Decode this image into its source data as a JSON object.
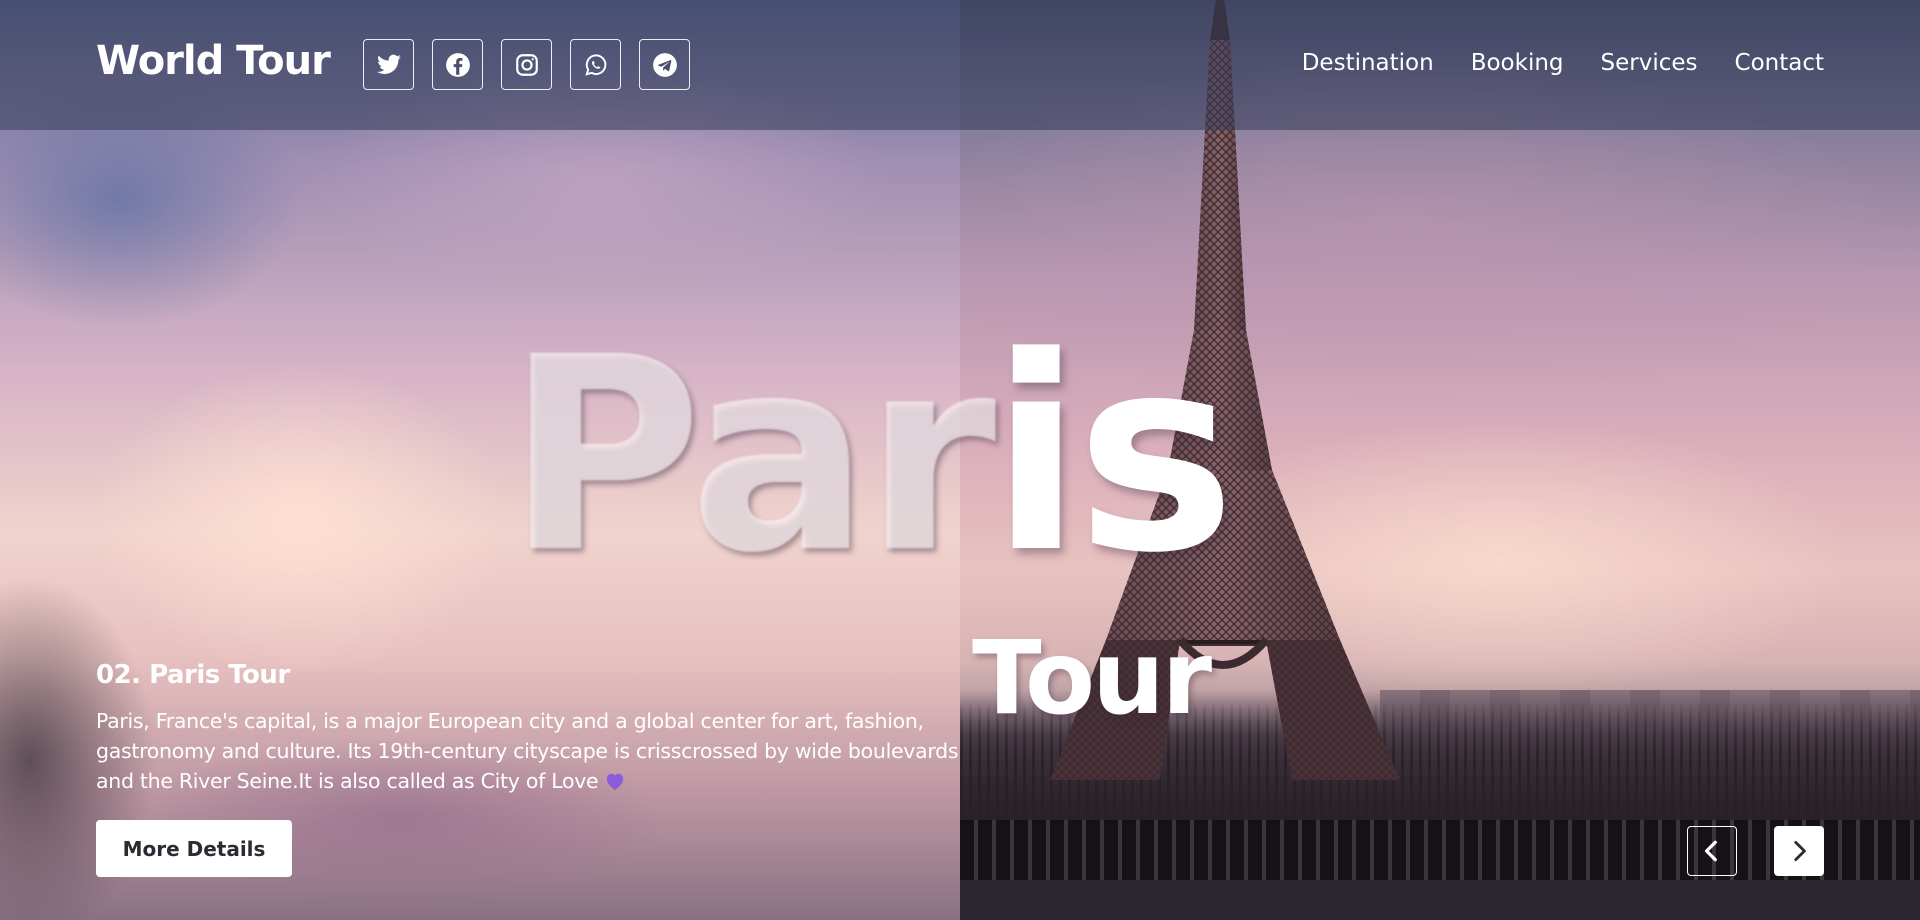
{
  "header": {
    "brand": "World Tour",
    "socials": [
      {
        "icon": "twitter-icon"
      },
      {
        "icon": "facebook-icon"
      },
      {
        "icon": "instagram-icon"
      },
      {
        "icon": "whatsapp-icon"
      },
      {
        "icon": "telegram-icon"
      }
    ],
    "nav": [
      "Destination",
      "Booking",
      "Services",
      "Contact"
    ]
  },
  "hero": {
    "title_ghost": "Par",
    "title_solid": "is",
    "subtitle": "Tour"
  },
  "info": {
    "heading": "02. Paris Tour",
    "description": "Paris, France's capital, is a major European city and a global center for art, fashion, gastronomy and culture. Its 19th-century cityscape is crisscrossed by wide boulevards and the River Seine.It is also called as City of Love",
    "heart_icon": "purple-heart-icon",
    "button_label": "More Details"
  },
  "carousel": {
    "prev_icon": "chevron-left-icon",
    "next_icon": "chevron-right-icon"
  },
  "colors": {
    "heart": "#8a5cd8",
    "header_overlay": "#343a58"
  }
}
